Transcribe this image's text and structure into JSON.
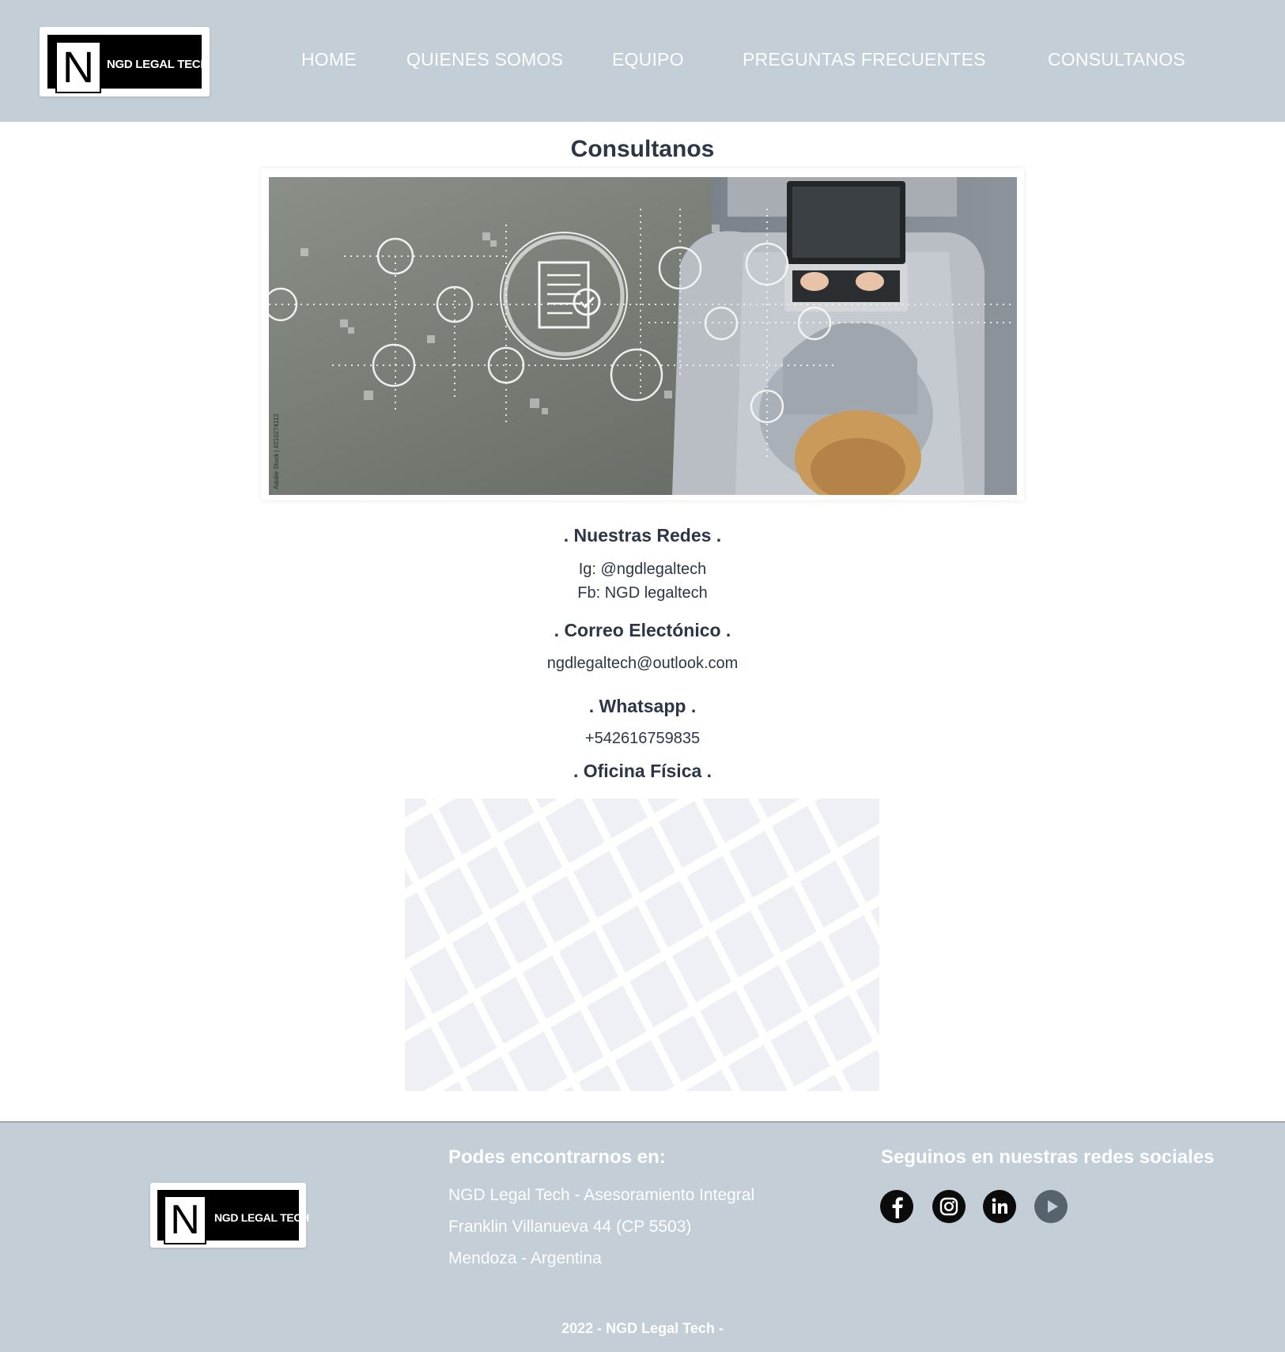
{
  "header": {
    "logo_text": "NGD LEGAL TECH",
    "logo_letter": "N",
    "nav": [
      {
        "label": "HOME"
      },
      {
        "label": "QUIENES SOMOS"
      },
      {
        "label": "EQUIPO"
      },
      {
        "label": "PREGUNTAS FRECUENTES"
      },
      {
        "label": "CONSULTANOS"
      }
    ]
  },
  "main": {
    "title": "Consultanos",
    "hero_watermark": "Adobe Stock | #210274112",
    "redes": {
      "heading": ". Nuestras Redes .",
      "ig": "Ig: @ngdlegaltech",
      "fb": "Fb: NGD legaltech"
    },
    "correo": {
      "heading": ". Correo Electónico .",
      "email": "ngdlegaltech@outlook.com"
    },
    "whatsapp": {
      "heading": ". Whatsapp .",
      "phone": "+542616759835"
    },
    "oficina": {
      "heading": ". Oficina Física ."
    }
  },
  "footer": {
    "logo_text": "NGD LEGAL TECH",
    "logo_letter": "N",
    "address_heading": "Podes encontrarnos en:",
    "address_lines": [
      "NGD Legal Tech - Asesoramiento Integral",
      "Franklin Villanueva 44 (CP 5503)",
      "Mendoza - Argentina"
    ],
    "social_heading": "Seguinos en nuestras redes sociales",
    "social_icons": [
      "facebook-icon",
      "instagram-icon",
      "linkedin-icon",
      "youtube-play-icon"
    ],
    "copyright": "2022 - NGD Legal Tech -"
  },
  "colors": {
    "header_bg": "#c3ced7",
    "text_dark": "#2c3645",
    "map_block": "#eef0f5"
  }
}
